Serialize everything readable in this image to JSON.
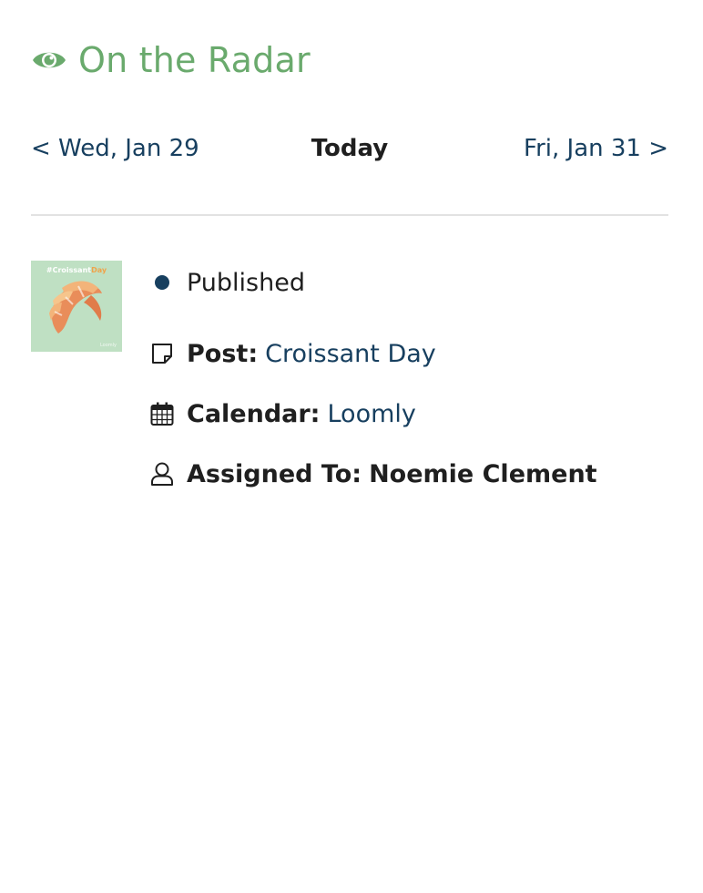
{
  "header": {
    "title": "On the Radar",
    "icon": "eye-icon",
    "color": "#6aaa6d"
  },
  "nav": {
    "prev_label": "< Wed, Jan 29",
    "today_label": "Today",
    "next_label": "Fri, Jan 31 >",
    "link_color": "#173f5f"
  },
  "post_item": {
    "thumbnail": {
      "hashtag_prefix": "#Croissant",
      "hashtag_suffix": "Day",
      "brand": "Loomly",
      "background": "#bfe0c3"
    },
    "status": {
      "label": "Published",
      "color": "#173f5f"
    },
    "post": {
      "label": "Post:",
      "value": "Croissant Day",
      "icon": "sticky-note-icon"
    },
    "calendar": {
      "label": "Calendar:",
      "value": "Loomly",
      "icon": "calendar-icon"
    },
    "assigned": {
      "label": "Assigned To:",
      "value": "Noemie Clement",
      "icon": "user-icon"
    }
  }
}
